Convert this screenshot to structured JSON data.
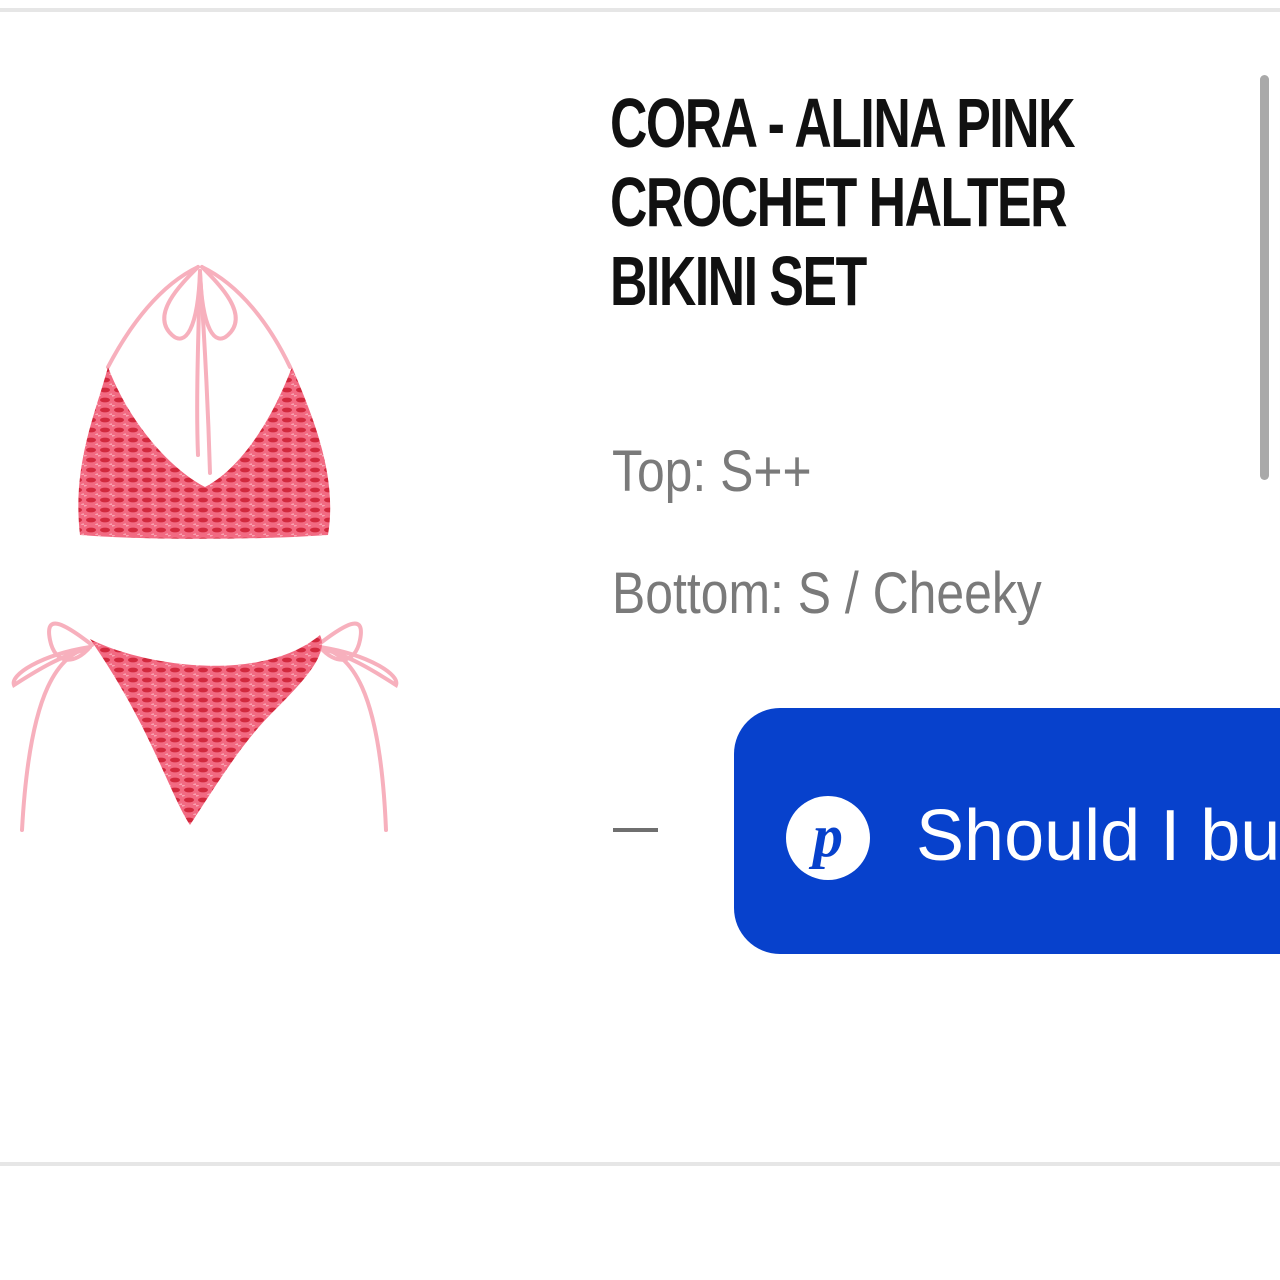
{
  "product": {
    "title_lines": [
      "CORA - ALINA PINK",
      "CROCHET HALTER",
      "BIKINI SET"
    ],
    "sizes": {
      "top": "Top: S++",
      "bottom": "Bottom: S / Cheeky"
    }
  },
  "cta": {
    "logo_letter": "p",
    "label": "Should I bu"
  },
  "colors": {
    "cta_background": "#0741cc",
    "fabric_pink": "#f0607a",
    "fabric_red": "#d2283d",
    "tie_pink": "#f7b0bd"
  },
  "icons": {
    "cta_logo": "p-circle-icon"
  }
}
